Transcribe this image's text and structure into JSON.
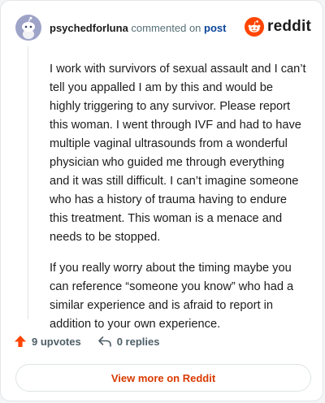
{
  "header": {
    "username": "psychedforluna",
    "action_text": "commented on",
    "post_link": "post",
    "brand_name": "reddit",
    "brand_color": "#ff4500"
  },
  "comment": {
    "paragraphs": [
      "I work with survivors of sexual assault and I can’t tell you appalled I am by this and would be highly triggering to any survivor. Please report this woman. I went through IVF and had to have multiple vaginal ultrasounds from a wonderful physician who guided me through everything and it was still difficult. I can’t imagine someone who has a history of trauma having to endure this treatment. This woman is a menace and needs to be stopped.",
      "If you really worry about the timing maybe you can reference “someone you know” who had a similar experience and is afraid to report in addition to your own experience."
    ]
  },
  "actions": {
    "upvotes_label": "9 upvotes",
    "replies_label": "0 replies",
    "upvote_icon": "upvote-arrow-icon",
    "reply_icon": "reply-arrow-icon",
    "upvote_color": "#ff4500"
  },
  "footer": {
    "view_more_label": "View more on Reddit",
    "link_color": "#d93a00"
  }
}
